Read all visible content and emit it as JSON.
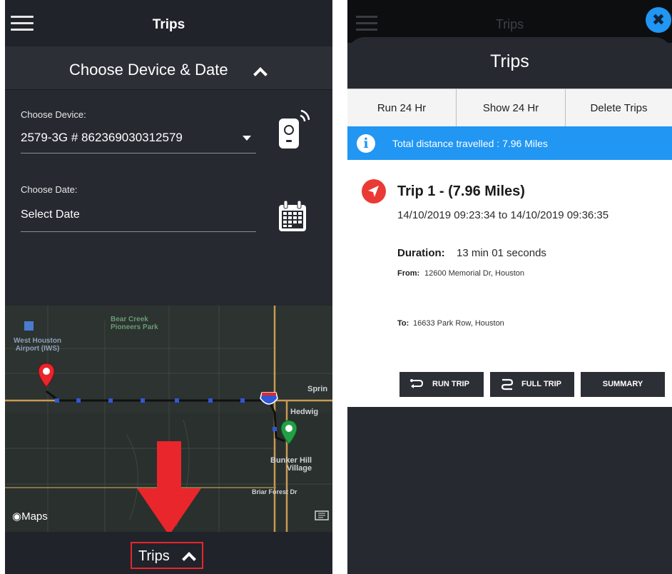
{
  "left": {
    "header": {
      "title": "Trips"
    },
    "chooser": {
      "label": "Choose Device & Date"
    },
    "device": {
      "label": "Choose Device:",
      "value": "2579-3G # 862369030312579"
    },
    "date": {
      "label": "Choose Date:",
      "value": "Select Date"
    },
    "map": {
      "labels": {
        "park": "Bear Creek\nPioneers Park",
        "airport": "West Houston\nAirport (IWS)",
        "hedwig": "Hedwig",
        "spring": "Sprin",
        "bunker": "Bunker Hill\nVillage",
        "briar": "Briar Forest Dr",
        "maps": "Maps",
        "interstate": "10"
      }
    },
    "bottom": {
      "trips_label": "Trips"
    }
  },
  "right": {
    "header_dim": {
      "title": "Trips"
    },
    "sheet": {
      "title": "Trips"
    },
    "buttons": {
      "run": "Run 24 Hr",
      "show": "Show 24 Hr",
      "delete": "Delete Trips"
    },
    "info": {
      "text": "Total distance travelled : 7.96 Miles"
    },
    "trip": {
      "title": "Trip 1 - (7.96 Miles)",
      "range": "14/10/2019 09:23:34 to 14/10/2019 09:36:35",
      "duration_label": "Duration:",
      "duration_value": "13 min 01 seconds",
      "from_label": "From:",
      "from_value": "12600 Memorial Dr,  Houston",
      "to_label": "To:",
      "to_value": "16633 Park Row,  Houston"
    },
    "actions": {
      "run_trip": "RUN TRIP",
      "full_trip": "FULL TRIP",
      "summary": "SUMMARY"
    }
  },
  "colors": {
    "accent_blue": "#2196f3",
    "danger_red": "#e8262b",
    "dark_bg": "#262930",
    "start_pin": "#e8262b",
    "end_pin": "#22a046"
  }
}
